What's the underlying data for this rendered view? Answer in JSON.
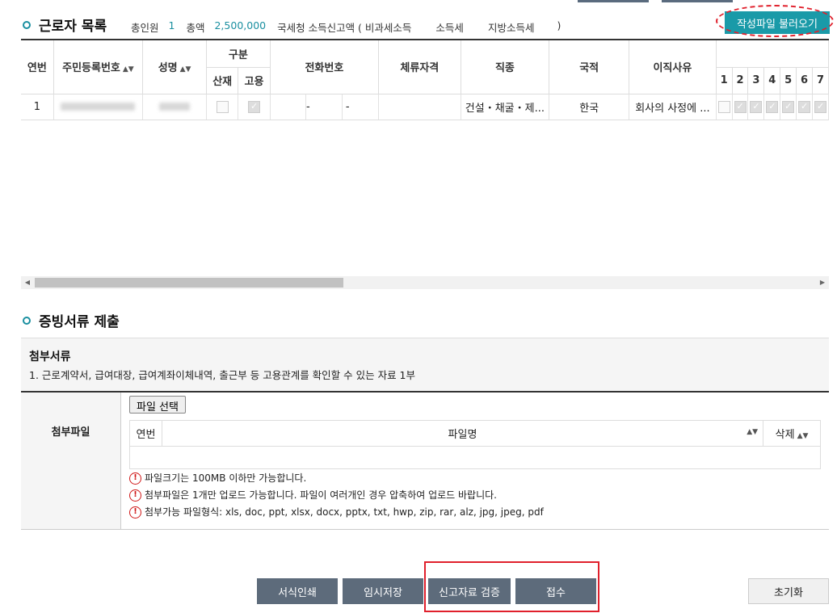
{
  "workers": {
    "title": "근로자 목록",
    "summary": {
      "total_label": "총인원",
      "total_value": "1",
      "amount_label": "총액",
      "amount_value": "2,500,000",
      "nts_label": "국세청 소득신고액 ( 비과세소득",
      "income_tax_label": "소득세",
      "local_tax_label": "지방소득세",
      "close_paren": ")"
    },
    "load_button": "작성파일 불러오기",
    "columns": {
      "seq": "연번",
      "rrn": "주민등록번호",
      "name": "성명",
      "category": "구분",
      "category_sub": [
        "산재",
        "고용"
      ],
      "phone": "전화번호",
      "residence": "체류자격",
      "job": "직종",
      "nationality": "국적",
      "reason": "이직사유",
      "months": [
        "1",
        "2",
        "3",
        "4",
        "5",
        "6",
        "7"
      ]
    },
    "rows": [
      {
        "seq": "1",
        "phone_sep1": "-",
        "phone_sep2": "-",
        "job": "건설・채굴・제...",
        "nationality": "한국",
        "reason": "회사의 사정에 ...",
        "sanjae": false,
        "goyong": true,
        "months": [
          false,
          true,
          true,
          true,
          true,
          true,
          true
        ]
      }
    ]
  },
  "evidence": {
    "title": "증빙서류 제출",
    "attach_heading": "첨부서류",
    "attach_desc": "1. 근로계약서, 급여대장, 급여계좌이체내역, 출근부 등 고용관계를 확인할 수 있는 자료 1부",
    "file_label": "첨부파일",
    "file_button": "파일 선택",
    "file_columns": {
      "seq": "연번",
      "filename": "파일명",
      "delete": "삭제"
    },
    "notes": [
      "파일크기는 100MB 이하만 가능합니다.",
      "첨부파일은 1개만 업로드 가능합니다. 파일이 여러개인 경우 압축하여 업로드 바랍니다.",
      "첨부가능 파일형식: xls, doc, ppt, xlsx, docx, pptx, txt, hwp, zip, rar, alz, jpg, jpeg, pdf"
    ]
  },
  "buttons": {
    "print": "서식인쇄",
    "temp_save": "임시저장",
    "verify": "신고자료 검증",
    "submit": "접수",
    "reset": "초기화"
  },
  "colors": {
    "accent": "#1a9aa8",
    "dark_button": "#5d6b7b",
    "highlight": "#e0202c"
  }
}
